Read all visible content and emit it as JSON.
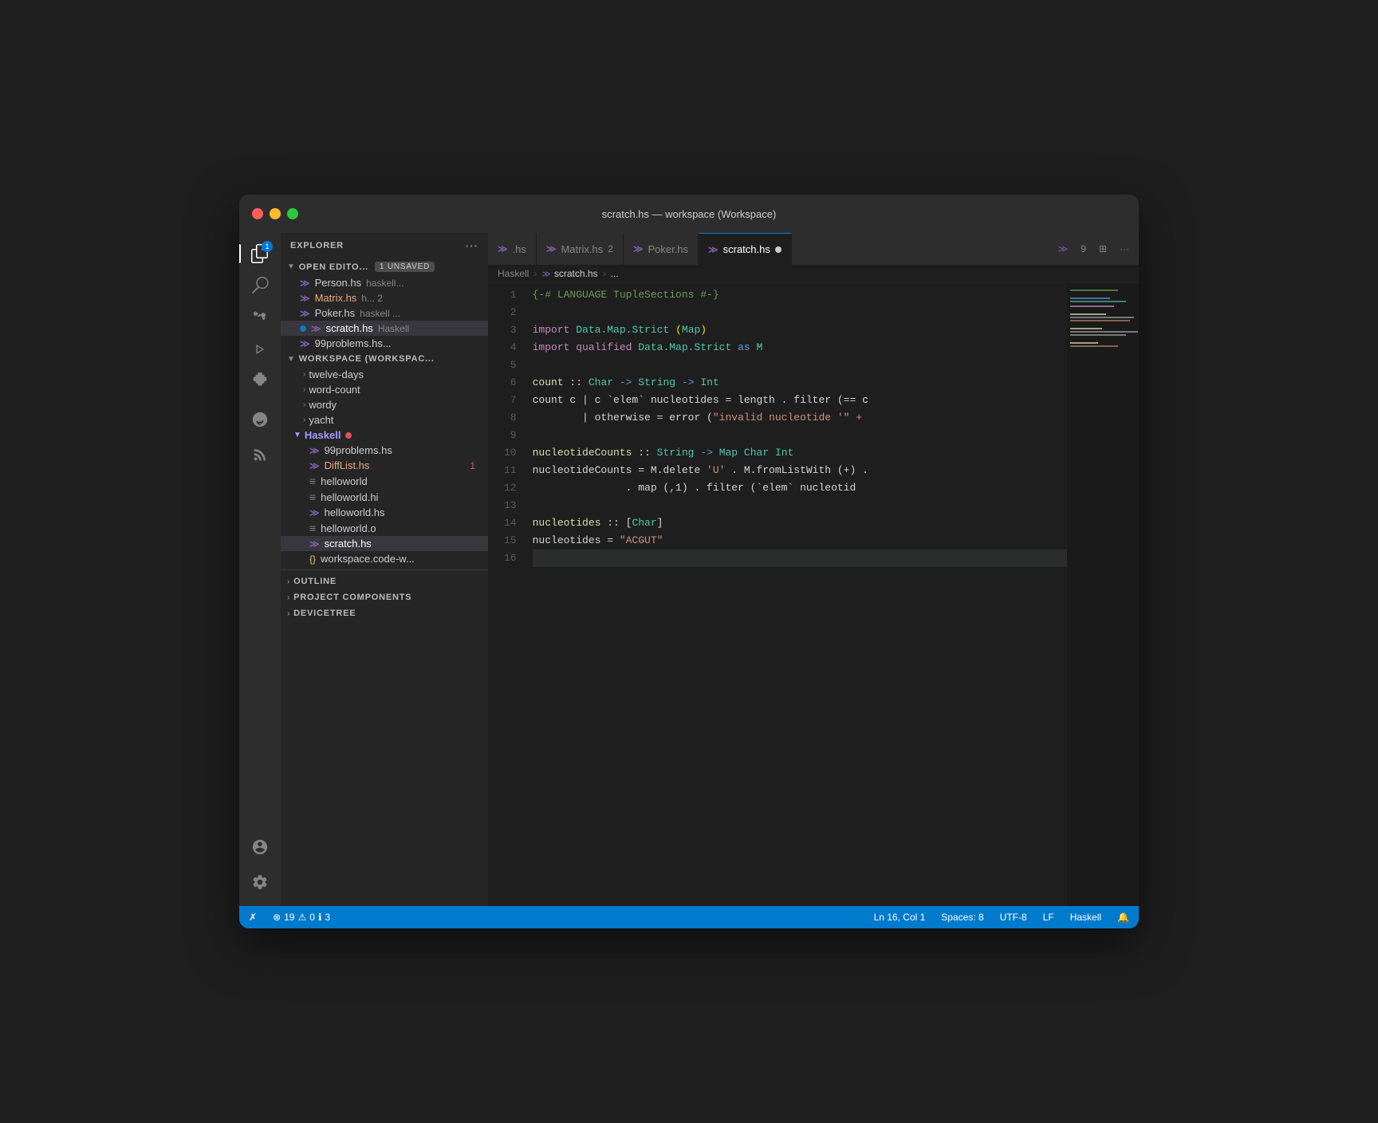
{
  "window": {
    "title": "scratch.hs — workspace (Workspace)"
  },
  "titlebar": {
    "title": "scratch.hs — workspace (Workspace)"
  },
  "activitybar": {
    "icons": [
      {
        "name": "explorer",
        "label": "Explorer",
        "active": true,
        "badge": "1"
      },
      {
        "name": "search",
        "label": "Search",
        "active": false
      },
      {
        "name": "source-control",
        "label": "Source Control",
        "active": false
      },
      {
        "name": "run",
        "label": "Run and Debug",
        "active": false
      },
      {
        "name": "extensions",
        "label": "Extensions",
        "active": false
      },
      {
        "name": "remote",
        "label": "Remote Explorer",
        "active": false
      },
      {
        "name": "rss",
        "label": "Live Share",
        "active": false
      }
    ],
    "bottom": [
      {
        "name": "account",
        "label": "Account"
      },
      {
        "name": "settings",
        "label": "Settings"
      }
    ]
  },
  "sidebar": {
    "header": "EXPLORER",
    "header_dots": "···",
    "open_editors": {
      "label": "OPEN EDITO...",
      "badge": "1 UNSAVED",
      "files": [
        {
          "name": "Person.hs",
          "hint": "haskell...",
          "modified": false,
          "active": false
        },
        {
          "name": "Matrix.hs",
          "hint": "h... 2",
          "modified": true,
          "active": false
        },
        {
          "name": "Poker.hs",
          "hint": "haskell ...",
          "modified": false,
          "active": false
        },
        {
          "name": "scratch.hs",
          "hint": "Haskell",
          "modified": true,
          "dot": true,
          "active": true
        }
      ]
    },
    "workspace": {
      "label": "WORKSPACE (WORKSPAC...",
      "folders": [
        {
          "name": "twelve-days"
        },
        {
          "name": "word-count"
        },
        {
          "name": "wordy"
        },
        {
          "name": "yacht"
        }
      ]
    },
    "haskell": {
      "label": "Haskell",
      "has_dot": true,
      "files": [
        {
          "name": "99problems.hs",
          "type": "lambda"
        },
        {
          "name": "DiffList.hs",
          "type": "lambda",
          "modified": true,
          "badge": "1"
        },
        {
          "name": "helloworld",
          "type": "equals"
        },
        {
          "name": "helloworld.hi",
          "type": "equals"
        },
        {
          "name": "helloworld.hs",
          "type": "lambda"
        },
        {
          "name": "helloworld.o",
          "type": "equals"
        },
        {
          "name": "scratch.hs",
          "type": "lambda",
          "active": true
        },
        {
          "name": "workspace.code-w...",
          "type": "braces"
        }
      ]
    },
    "outline": {
      "label": "OUTLINE"
    },
    "project_components": {
      "label": "PROJECT COMPONENTS"
    },
    "devicetree": {
      "label": "DEVICETREE"
    }
  },
  "tabs": [
    {
      "label": ".hs",
      "type": "plain",
      "active": false
    },
    {
      "label": "Matrix.hs",
      "type": "lambda",
      "badge": "2",
      "active": false,
      "modified": true
    },
    {
      "label": "Poker.hs",
      "type": "lambda",
      "active": false
    },
    {
      "label": "scratch.hs",
      "type": "lambda",
      "active": true,
      "dot": true
    },
    {
      "label": "9",
      "type": "number",
      "active": false
    }
  ],
  "breadcrumb": {
    "parts": [
      "Haskell",
      "scratch.hs",
      "..."
    ]
  },
  "code": {
    "lines": [
      {
        "num": 1,
        "tokens": [
          {
            "t": "{-# LANGUAGE TupleSections #-}",
            "c": "c-pragma"
          }
        ]
      },
      {
        "num": 2,
        "tokens": []
      },
      {
        "num": 3,
        "tokens": [
          {
            "t": "import",
            "c": "c-import"
          },
          {
            "t": " ",
            "c": "c-normal"
          },
          {
            "t": "Data.Map.Strict",
            "c": "c-module"
          },
          {
            "t": " ",
            "c": "c-normal"
          },
          {
            "t": "(",
            "c": "c-paren"
          },
          {
            "t": "Map",
            "c": "c-type"
          },
          {
            "t": ")",
            "c": "c-paren"
          }
        ]
      },
      {
        "num": 4,
        "tokens": [
          {
            "t": "import qualified",
            "c": "c-import"
          },
          {
            "t": " ",
            "c": "c-normal"
          },
          {
            "t": "Data.Map.Strict",
            "c": "c-module"
          },
          {
            "t": " ",
            "c": "c-normal"
          },
          {
            "t": "as",
            "c": "c-keyword"
          },
          {
            "t": " ",
            "c": "c-normal"
          },
          {
            "t": "M",
            "c": "c-type"
          }
        ]
      },
      {
        "num": 5,
        "tokens": []
      },
      {
        "num": 6,
        "tokens": [
          {
            "t": "count",
            "c": "c-func"
          },
          {
            "t": " :: ",
            "c": "c-normal"
          },
          {
            "t": "Char",
            "c": "c-type"
          },
          {
            "t": " -> ",
            "c": "c-arrow"
          },
          {
            "t": "String",
            "c": "c-type"
          },
          {
            "t": " -> ",
            "c": "c-arrow"
          },
          {
            "t": "Int",
            "c": "c-type"
          }
        ]
      },
      {
        "num": 7,
        "tokens": [
          {
            "t": "count c | c `elem` nucleotides = length . filter (== c",
            "c": "c-normal"
          }
        ]
      },
      {
        "num": 8,
        "tokens": [
          {
            "t": "        | otherwise = error (",
            "c": "c-normal"
          },
          {
            "t": "\"invalid nucleotide '\" +",
            "c": "c-string"
          }
        ]
      },
      {
        "num": 9,
        "tokens": []
      },
      {
        "num": 10,
        "tokens": [
          {
            "t": "nucleotideCounts",
            "c": "c-func"
          },
          {
            "t": " :: ",
            "c": "c-normal"
          },
          {
            "t": "String",
            "c": "c-type"
          },
          {
            "t": " -> ",
            "c": "c-arrow"
          },
          {
            "t": "Map",
            "c": "c-type"
          },
          {
            "t": " ",
            "c": "c-normal"
          },
          {
            "t": "Char",
            "c": "c-type"
          },
          {
            "t": " ",
            "c": "c-normal"
          },
          {
            "t": "Int",
            "c": "c-type"
          }
        ]
      },
      {
        "num": 11,
        "tokens": [
          {
            "t": "nucleotideCounts = M.delete ",
            "c": "c-normal"
          },
          {
            "t": "'U'",
            "c": "c-char"
          },
          {
            "t": " . M.fromListWith (+) .",
            "c": "c-normal"
          }
        ]
      },
      {
        "num": 12,
        "tokens": [
          {
            "t": "               . map (,1) . filter (`elem` nucleotid",
            "c": "c-normal"
          }
        ]
      },
      {
        "num": 13,
        "tokens": []
      },
      {
        "num": 14,
        "tokens": [
          {
            "t": "nucleotides",
            "c": "c-func"
          },
          {
            "t": " :: [",
            "c": "c-normal"
          },
          {
            "t": "Char",
            "c": "c-type"
          },
          {
            "t": "]",
            "c": "c-normal"
          }
        ]
      },
      {
        "num": 15,
        "tokens": [
          {
            "t": "nucleotides = ",
            "c": "c-normal"
          },
          {
            "t": "\"ACGUT\"",
            "c": "c-string"
          }
        ]
      },
      {
        "num": 16,
        "tokens": []
      }
    ]
  },
  "statusbar": {
    "branch": "✗",
    "errors": "19",
    "warnings": "0",
    "info": "3",
    "position": "Ln 16, Col 1",
    "spaces": "Spaces: 8",
    "encoding": "UTF-8",
    "line_ending": "LF",
    "language": "Haskell",
    "notifications": "🔔"
  }
}
